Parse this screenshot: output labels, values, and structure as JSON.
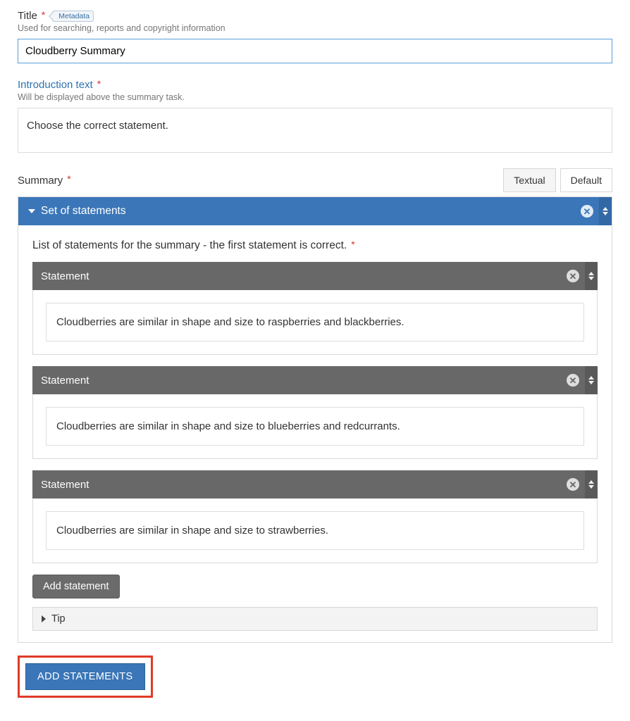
{
  "title": {
    "label": "Title",
    "badge": "Metadata",
    "description": "Used for searching, reports and copyright information",
    "value": "Cloudberry Summary"
  },
  "intro": {
    "label": "Introduction text",
    "description": "Will be displayed above the summary task.",
    "value": "Choose the correct statement."
  },
  "summary": {
    "label": "Summary",
    "tabs": {
      "textual": "Textual",
      "default": "Default"
    },
    "set_title": "Set of statements",
    "list_label": "List of statements for the summary - the first statement is correct.",
    "statements": [
      {
        "header": "Statement",
        "text": "Cloudberries are similar in shape and size to raspberries and blackberries."
      },
      {
        "header": "Statement",
        "text": "Cloudberries are similar in shape and size to blueberries and redcurrants."
      },
      {
        "header": "Statement",
        "text": "Cloudberries are similar in shape and size to strawberries."
      }
    ],
    "add_statement_btn": "Add statement",
    "tip_label": "Tip",
    "add_statements_btn": "ADD STATEMENTS"
  }
}
